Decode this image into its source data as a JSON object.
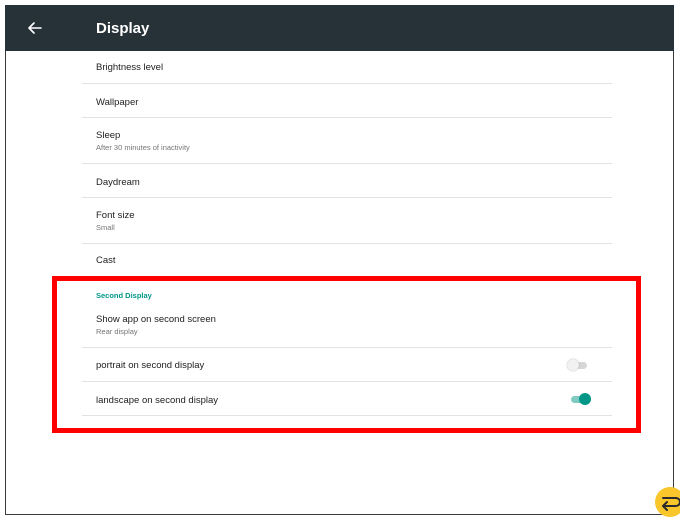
{
  "appbar": {
    "title": "Display",
    "back_icon": "arrow-left-icon"
  },
  "settings": [
    {
      "title": "Brightness level",
      "summary": ""
    },
    {
      "title": "Wallpaper",
      "summary": ""
    },
    {
      "title": "Sleep",
      "summary": "After 30 minutes of inactivity"
    },
    {
      "title": "Daydream",
      "summary": ""
    },
    {
      "title": "Font size",
      "summary": "Small"
    },
    {
      "title": "Cast",
      "summary": ""
    }
  ],
  "second_display": {
    "header": "Second Display",
    "show_app": {
      "title": "Show app on second screen",
      "summary": "Rear display"
    },
    "portrait": {
      "title": "portrait on second display",
      "enabled": false
    },
    "landscape": {
      "title": "landscape on second display",
      "enabled": true
    }
  },
  "colors": {
    "appbar": "#263238",
    "accent": "#009688",
    "highlight": "#ff0000",
    "fab": "#f9c62b"
  },
  "fab_icon": "return-arrow-icon"
}
